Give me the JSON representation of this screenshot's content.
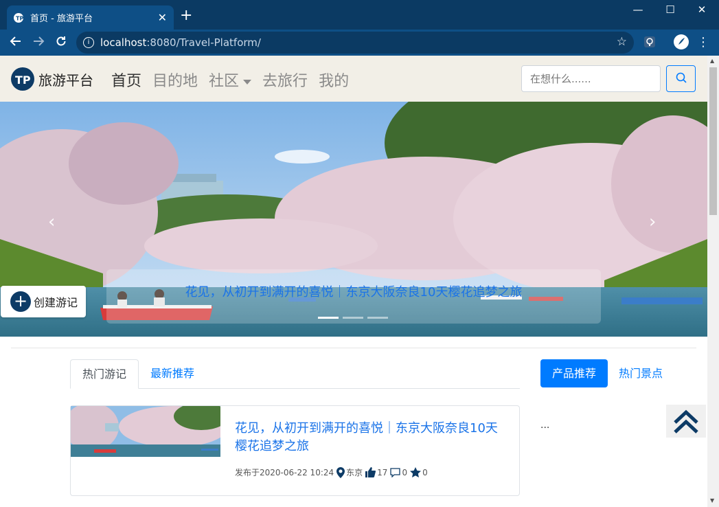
{
  "browser": {
    "tab_title": "首页 - 旅游平台",
    "url_host": "localhost",
    "url_rest": ":8080/Travel-Platform/",
    "new_tab": "+",
    "close_tab": "✕",
    "minimize": "—",
    "maximize": "☐",
    "close_window": "✕"
  },
  "navbar": {
    "brand": "旅游平台",
    "links": [
      "首页",
      "目的地",
      "社区",
      "去旅行",
      "我的"
    ],
    "search_placeholder": "在想什么......"
  },
  "carousel": {
    "caption": "花见，从初开到满开的喜悦｜东京大阪奈良10天樱花追梦之旅",
    "active_slide": 1,
    "slide_count": 3,
    "prev_icon": "‹",
    "next_icon": "›"
  },
  "create_button": {
    "label": "创建游记",
    "plus": "+"
  },
  "tabs": {
    "items": [
      "热门游记",
      "最新推荐"
    ]
  },
  "side_tabs": {
    "items": [
      "产品推荐",
      "热门景点"
    ]
  },
  "article": {
    "title": "花见，从初开到满开的喜悦｜东京大阪奈良10天樱花追梦之旅",
    "published": "发布于2020-06-22 10:24",
    "location": "东京",
    "likes": "17",
    "comments": "0",
    "favorites": "0"
  },
  "side_content": "...",
  "colors": {
    "primary": "#007bff",
    "navbar_bg": "#f2efe7",
    "brand_dark": "#0d3b66",
    "chrome": "#0e4f86"
  }
}
